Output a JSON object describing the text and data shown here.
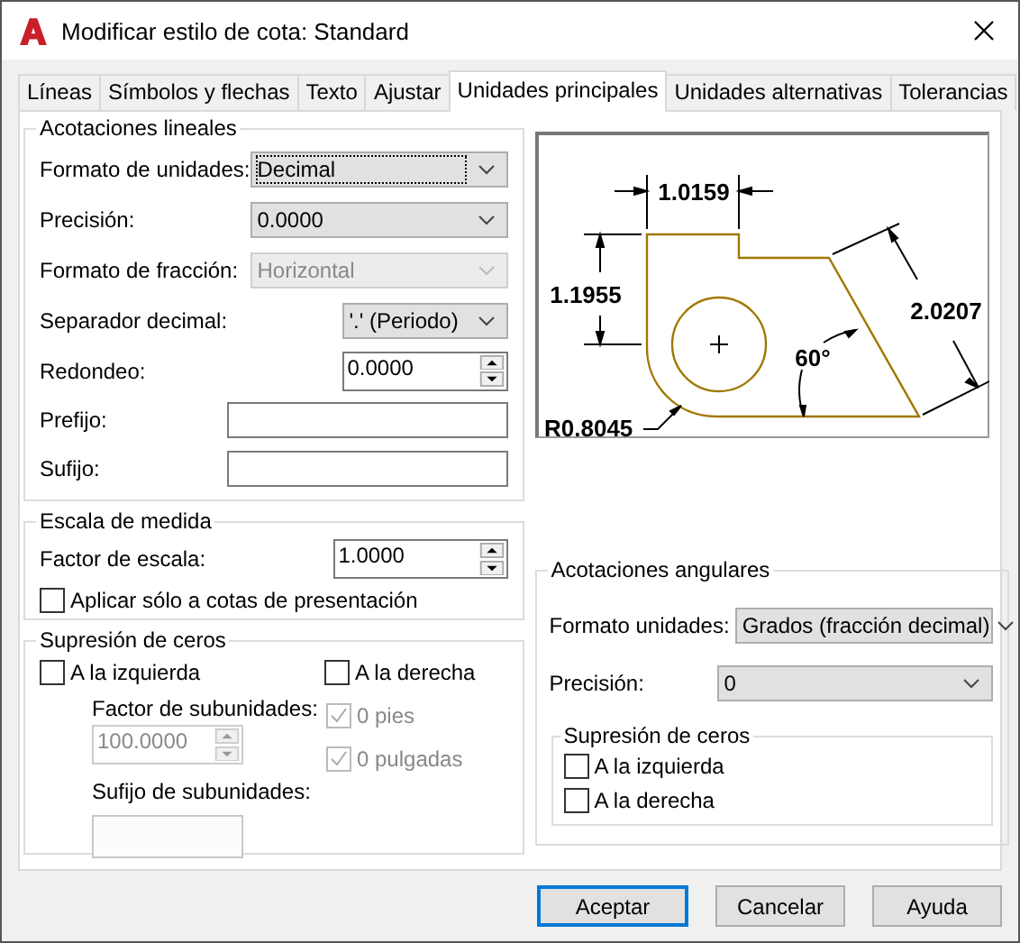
{
  "window": {
    "title": "Modificar estilo de cota: Standard"
  },
  "tabs": [
    {
      "label": "Líneas",
      "selected": false
    },
    {
      "label": "Símbolos y flechas",
      "selected": false
    },
    {
      "label": "Texto",
      "selected": false
    },
    {
      "label": "Ajustar",
      "selected": false
    },
    {
      "label": "Unidades principales",
      "selected": true
    },
    {
      "label": "Unidades alternativas",
      "selected": false
    },
    {
      "label": "Tolerancias",
      "selected": false
    }
  ],
  "linear": {
    "title": "Acotaciones lineales",
    "fields": [
      {
        "kind": "select",
        "label": "Formato de unidades:",
        "value": "Decimal",
        "disabled": false,
        "focused": true
      },
      {
        "kind": "select",
        "label": "Precisión:",
        "value": "0.0000",
        "disabled": false,
        "focused": false
      },
      {
        "kind": "select",
        "label": "Formato de fracción:",
        "value": "Horizontal",
        "disabled": true,
        "focused": false
      },
      {
        "kind": "short-select",
        "label": "Separador decimal:",
        "value": "'.' (Periodo)",
        "disabled": false,
        "focused": false
      },
      {
        "kind": "spin",
        "label": "Redondeo:",
        "value": "0.0000"
      },
      {
        "kind": "text",
        "label": "Prefijo:"
      },
      {
        "kind": "text",
        "label": "Sufijo:"
      }
    ]
  },
  "scale": {
    "title": "Escala de medida",
    "factor": {
      "label": "Factor de escala:",
      "value": "1.0000"
    },
    "apply": {
      "label": "Aplicar sólo a cotas de presentación",
      "checked": false
    }
  },
  "zeros": {
    "title": "Supresión de ceros",
    "leading": {
      "label": "A la izquierda",
      "checked": false
    },
    "trailing": {
      "label": "A la derecha",
      "checked": false
    },
    "sub_factor": {
      "label": "Factor de subunidades:",
      "value": "100.0000",
      "disabled": true
    },
    "sub_suffix": {
      "label": "Sufijo de subunidades:",
      "disabled": true
    },
    "feet": {
      "label": "0 pies",
      "checked": true,
      "disabled": true
    },
    "inches": {
      "label": "0 pulgadas",
      "checked": true,
      "disabled": true
    }
  },
  "preview": {
    "labels": [
      "1.0159",
      "1.1955",
      "2.0207",
      "60°",
      "R0.8045"
    ]
  },
  "angular": {
    "title": "Acotaciones angulares",
    "format": {
      "label": "Formato unidades:",
      "value": "Grados (fracción decimal)"
    },
    "precision": {
      "label": "Precisión:",
      "value": "0"
    },
    "zeros": {
      "title": "Supresión de ceros",
      "leading": {
        "label": "A la izquierda",
        "checked": false
      },
      "trailing": {
        "label": "A la derecha",
        "checked": false
      }
    }
  },
  "buttons": [
    {
      "label": "Aceptar",
      "default": true
    },
    {
      "label": "Cancelar",
      "default": false
    },
    {
      "label": "Ayuda",
      "default": false
    }
  ]
}
